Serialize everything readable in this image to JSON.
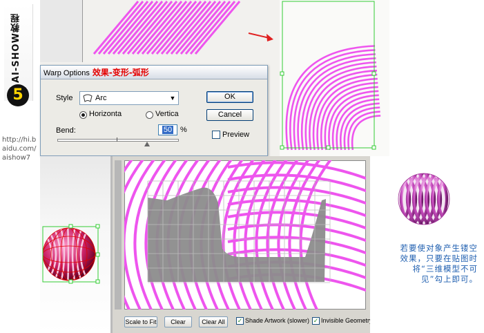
{
  "banner": {
    "brand": "AI-SHOW教程",
    "step": "5",
    "url_lines": "http://hi.b\naidu.com/\naishow7"
  },
  "dialog": {
    "title": "Warp Options",
    "title_annotation": "效果-变形-弧形",
    "style_label": "Style",
    "style_value": "Arc",
    "horizontal_label": "Horizonta",
    "vertical_label": "Vertica",
    "orientation_selected": "horizontal",
    "bend_label": "Bend:",
    "bend_value": "50",
    "bend_unit": "%",
    "ok_label": "OK",
    "cancel_label": "Cancel",
    "preview_label": "Preview",
    "preview_checked": false
  },
  "viewer": {
    "scale_to_fit": "Scale to Fit",
    "clear": "Clear",
    "clear_all": "Clear All",
    "shade_artwork": "Shade Artwork (slower)",
    "shade_checked": true,
    "invisible_geometry": "Invisible Geometry",
    "invisible_checked": true
  },
  "tip": {
    "text": "若要使对象产生镂空效果，只要在贴图时将“三维模型不可见”勾上即可。"
  },
  "colors": {
    "stripe": "#ee55ee",
    "selection": "#33cc33",
    "arrow": "#e02020",
    "gray_shape": "#8c8c8c"
  }
}
